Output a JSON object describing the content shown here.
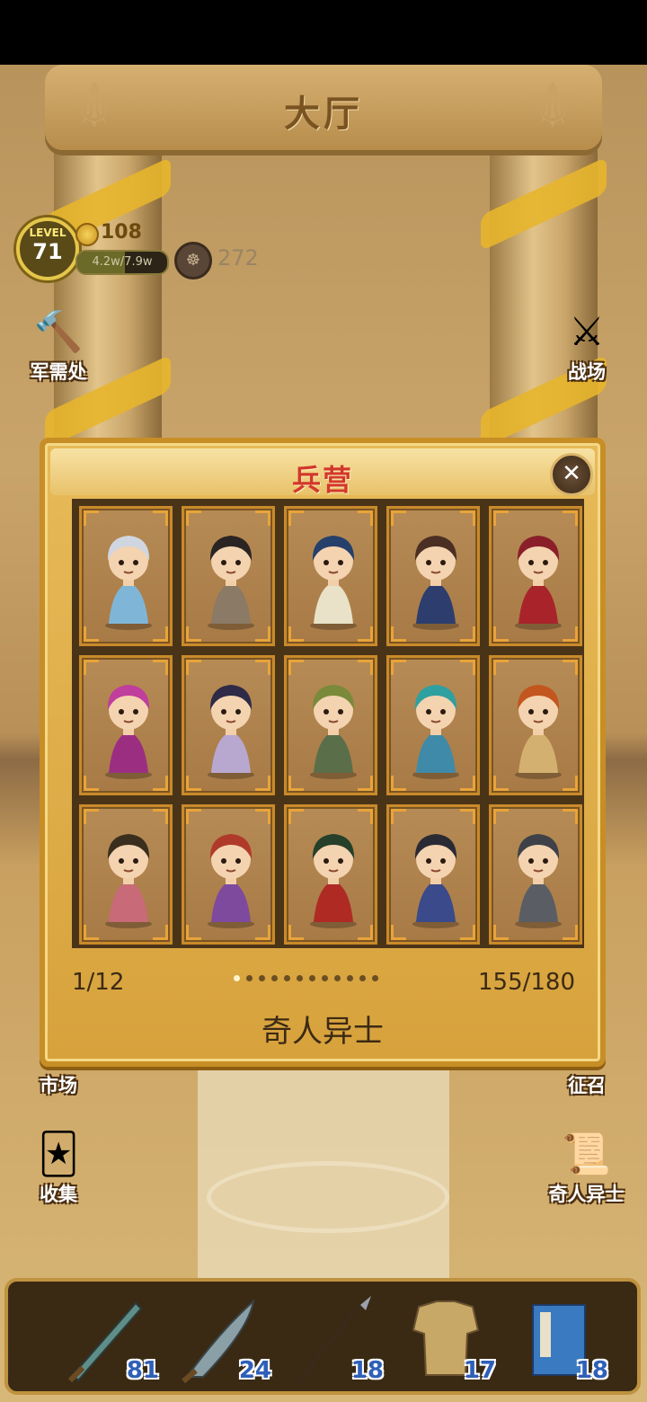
{
  "hall": {
    "title": "大厅",
    "player": {
      "level_label": "LEVEL",
      "level": "71",
      "coins": "108",
      "exp_text": "4.2w/7.9w",
      "exp_progress": 0.53,
      "power": "272"
    },
    "side_buttons": {
      "supply": "军需处",
      "battlefield": "战场",
      "market": "市场",
      "recruit": "征召",
      "collect": "收集",
      "strangers": "奇人异士"
    }
  },
  "barracks": {
    "title": "兵营",
    "close_icon": "close-icon",
    "cards": [
      {
        "name": "hero-card-1",
        "hair": "#cfd6e0",
        "robe": "#7fb6d8"
      },
      {
        "name": "hero-card-2",
        "hair": "#2a2522",
        "robe": "#8a7a66"
      },
      {
        "name": "hero-card-3",
        "hair": "#25406a",
        "robe": "#e9e2c8"
      },
      {
        "name": "hero-card-4",
        "hair": "#4a2f22",
        "robe": "#2d3e6e"
      },
      {
        "name": "hero-card-5",
        "hair": "#8a1f2a",
        "robe": "#a8242a"
      },
      {
        "name": "hero-card-6",
        "hair": "#c03e9c",
        "robe": "#9c2e82"
      },
      {
        "name": "hero-card-7",
        "hair": "#2e2a48",
        "robe": "#b8a8d0"
      },
      {
        "name": "hero-card-8",
        "hair": "#7a8a3a",
        "robe": "#5a6e4a"
      },
      {
        "name": "hero-card-9",
        "hair": "#2fa0a0",
        "robe": "#3e8aa8"
      },
      {
        "name": "hero-card-10",
        "hair": "#c2561e",
        "robe": "#d4b070"
      },
      {
        "name": "hero-card-11",
        "hair": "#3a2e1e",
        "robe": "#c86a78"
      },
      {
        "name": "hero-card-12",
        "hair": "#b03a2a",
        "robe": "#7e4a9e"
      },
      {
        "name": "hero-card-13",
        "hair": "#26402a",
        "robe": "#b02a24"
      },
      {
        "name": "hero-card-14",
        "hair": "#2a2a34",
        "robe": "#3a4a8a"
      },
      {
        "name": "hero-card-15",
        "hair": "#3e4248",
        "robe": "#5a5e64"
      }
    ],
    "page_indicator": "1/12",
    "page_dots": {
      "total": 12,
      "active": 1
    },
    "collection_count": "155/180",
    "category_name": "奇人异士"
  },
  "inventory": [
    {
      "item": "sword-icon",
      "count": "81",
      "color": "#5f8e88"
    },
    {
      "item": "broadsword-icon",
      "count": "24",
      "color": "#8aa0a6"
    },
    {
      "item": "spear-icon",
      "count": "18",
      "color": "#9aa2ac"
    },
    {
      "item": "armor-icon",
      "count": "17",
      "color": "#c8a866"
    },
    {
      "item": "book-icon",
      "count": "18",
      "color": "#3a7ac0"
    }
  ]
}
